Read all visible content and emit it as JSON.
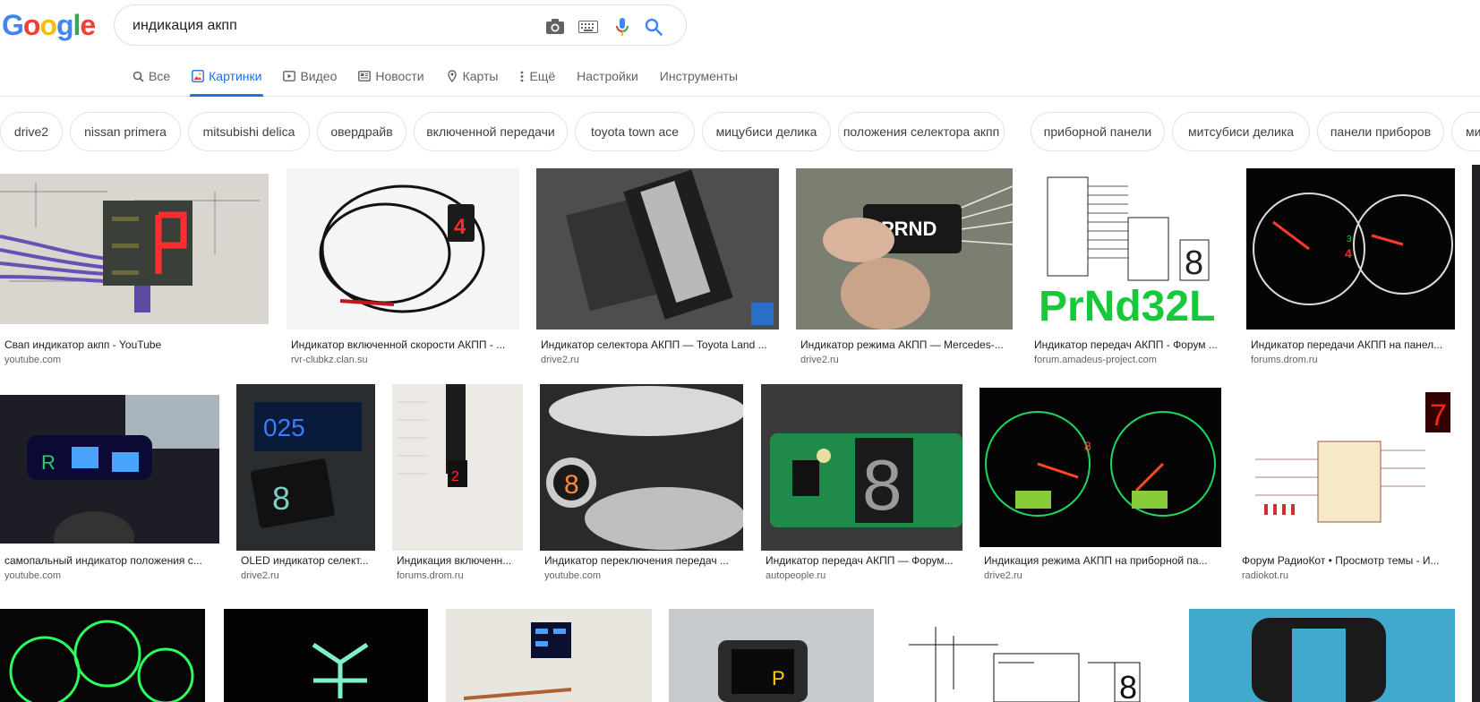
{
  "search": {
    "query": "индикация акпп"
  },
  "logo": {
    "letters": [
      "G",
      "o",
      "o",
      "g",
      "l",
      "e"
    ],
    "colors": [
      "#4285F4",
      "#EA4335",
      "#FBBC05",
      "#4285F4",
      "#34A853",
      "#EA4335"
    ]
  },
  "tabs": [
    {
      "label": "Все",
      "icon": "search-icon"
    },
    {
      "label": "Картинки",
      "icon": "image-icon",
      "active": true
    },
    {
      "label": "Видео",
      "icon": "video-icon"
    },
    {
      "label": "Новости",
      "icon": "news-icon"
    },
    {
      "label": "Карты",
      "icon": "map-icon"
    },
    {
      "label": "Ещё",
      "icon": "more-icon"
    },
    {
      "label": "Настройки"
    },
    {
      "label": "Инструменты"
    }
  ],
  "chips": [
    "drive2",
    "nissan primera",
    "mitsubishi delica",
    "овердрайв",
    "включенной передачи",
    "toyota town ace",
    "мицубиси делика",
    "положения селектора акпп",
    "приборной панели",
    "митсубиси делика",
    "панели приборов",
    "ми"
  ],
  "results": [
    {
      "caption": "Свап индикатор акпп - YouTube",
      "source": "youtube.com"
    },
    {
      "caption": "Индикатор включенной скорости АКПП - ...",
      "source": "rvr-clubkz.clan.su"
    },
    {
      "caption": "Индикатор селектора АКПП — Toyota Land ...",
      "source": "drive2.ru"
    },
    {
      "caption": "Индикатор режима АКПП — Mercedes-...",
      "source": "drive2.ru"
    },
    {
      "caption": "Индикатор передач АКПП - Форум ...",
      "source": "forum.amadeus-project.com"
    },
    {
      "caption": "Индикатор передачи АКПП на панел...",
      "source": "forums.drom.ru"
    },
    {
      "caption": "самопальный индикатор положения с...",
      "source": "youtube.com"
    },
    {
      "caption": "OLED индикатор селект...",
      "source": "drive2.ru"
    },
    {
      "caption": "Индикация включенн...",
      "source": "forums.drom.ru"
    },
    {
      "caption": "Индикатор переключения передач ...",
      "source": "youtube.com"
    },
    {
      "caption": "Индикатор передач АКПП — Форум...",
      "source": "autopeople.ru"
    },
    {
      "caption": "Индикация режима АКПП на приборной па...",
      "source": "drive2.ru"
    },
    {
      "caption": "Форум РадиоКот • Просмотр темы - И...",
      "source": "radiokot.ru"
    }
  ]
}
